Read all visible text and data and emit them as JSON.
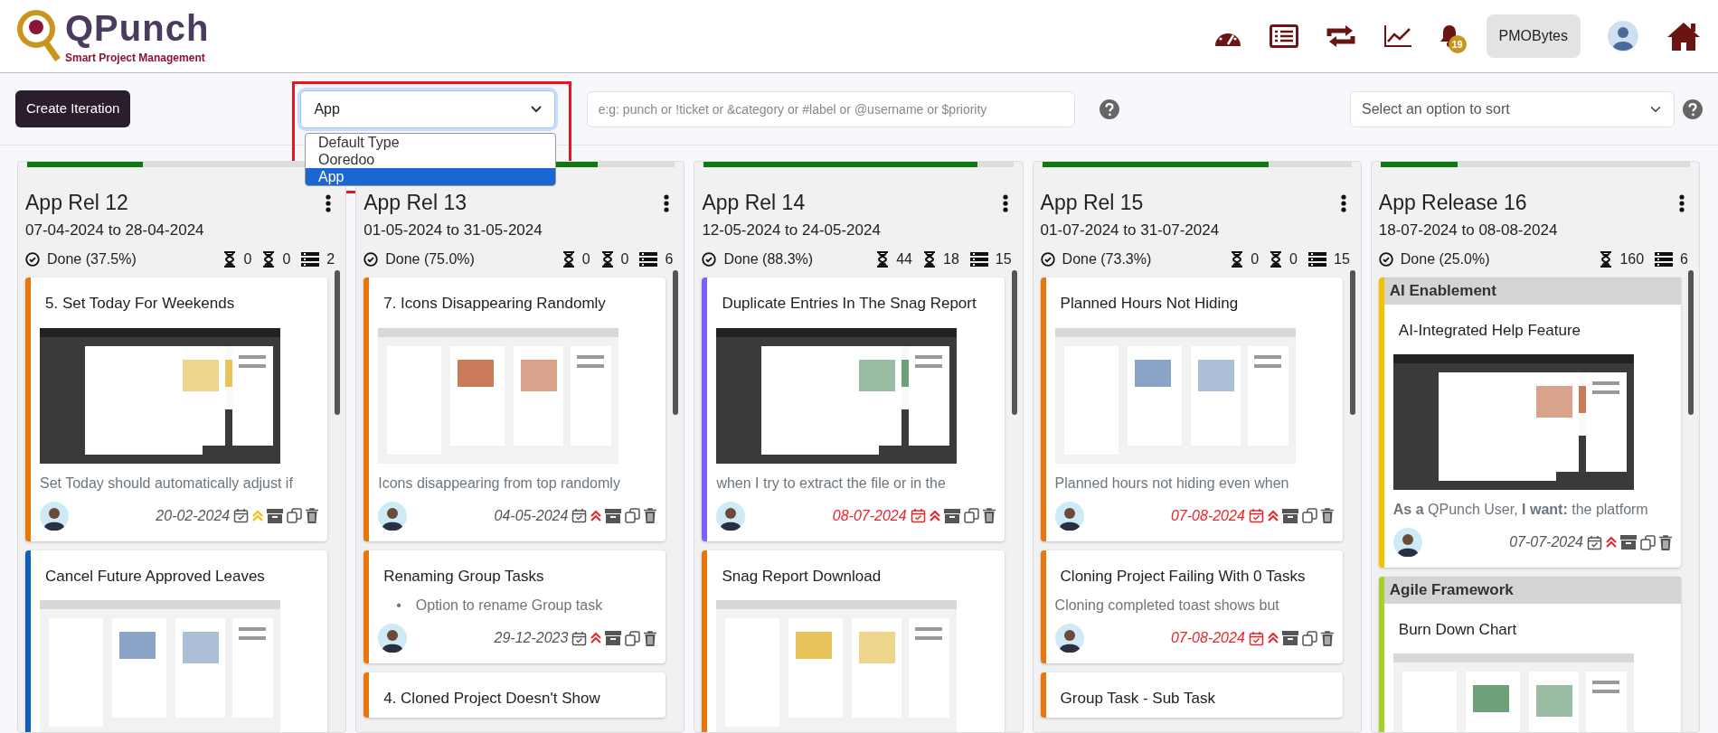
{
  "header": {
    "logo_title": "QPunch",
    "logo_subtitle": "Smart Project Management",
    "notification_count": "19",
    "user_button": "PMOBytes"
  },
  "toolbar": {
    "create_button": "Create Iteration",
    "type_select": {
      "value": "App",
      "expanded": true,
      "options": [
        {
          "label": "Default Type",
          "selected": false
        },
        {
          "label": "Ooredoo",
          "selected": false
        },
        {
          "label": "App",
          "selected": true
        }
      ]
    },
    "search": {
      "placeholder": "e:g: punch or !ticket or &category or #label or @username or $priority"
    },
    "sort_select": {
      "placeholder": "Select an option to sort"
    }
  },
  "iterations": [
    {
      "title": "App Rel 12",
      "dates": "07-04-2024 to 28-04-2024",
      "level": 0.375,
      "done": "Done (37.5%)",
      "stats": [
        {
          "kind": "hourglass",
          "value": "0"
        },
        {
          "kind": "hourglass",
          "value": "0"
        },
        {
          "kind": "list",
          "value": "2"
        }
      ],
      "cards": [
        {
          "title": "5. Set Today For Weekends",
          "color": "#e8760a",
          "picture": true,
          "description": "Set Today should automatically adjust if",
          "date": "20-02-2024",
          "overdue": false,
          "high_priority": false
        },
        {
          "title": "Cancel Future Approved Leaves",
          "color": "#0d5fb8",
          "picture": true
        }
      ]
    },
    {
      "title": "App Rel 13",
      "dates": "01-05-2024 to 31-05-2024",
      "level": 0.75,
      "done": "Done (75.0%)",
      "stats": [
        {
          "kind": "hourglass",
          "value": "0"
        },
        {
          "kind": "hourglass",
          "value": "0"
        },
        {
          "kind": "list",
          "value": "6"
        }
      ],
      "cards": [
        {
          "title": "7. Icons Disappearing Randomly",
          "color": "#e8760a",
          "picture": true,
          "description": "Icons disappearing from top randomly",
          "date": "04-05-2024",
          "overdue": false,
          "high_priority": true
        },
        {
          "title": "Renaming Group Tasks",
          "color": "#e8760a",
          "bullets": [
            {
              "marker": "•",
              "text": "Option to rename Group task"
            }
          ],
          "date": "29-12-2023",
          "overdue": false,
          "high_priority": true
        },
        {
          "title": "4. Cloned Project Doesn't Show",
          "color": "#e8760a"
        }
      ]
    },
    {
      "title": "App Rel 14",
      "dates": "12-05-2024 to 24-05-2024",
      "level": 0.883,
      "done": "Done (88.3%)",
      "stats": [
        {
          "kind": "hourglass",
          "value": "44"
        },
        {
          "kind": "hourglass",
          "value": "18"
        },
        {
          "kind": "list",
          "value": "15"
        }
      ],
      "cards": [
        {
          "title": "Duplicate Entries In The Snag Report",
          "color": "#7b61ff",
          "picture": true,
          "description": "when I try to extract the file or in the",
          "date": "08-07-2024",
          "overdue": true,
          "high_priority": true
        },
        {
          "title": "Snag Report Download",
          "color": "#e8760a",
          "picture": true
        }
      ]
    },
    {
      "title": "App Rel 15",
      "dates": "01-07-2024 to 31-07-2024",
      "level": 0.733,
      "done": "Done (73.3%)",
      "stats": [
        {
          "kind": "hourglass",
          "value": "0"
        },
        {
          "kind": "hourglass",
          "value": "0"
        },
        {
          "kind": "list",
          "value": "15"
        }
      ],
      "cards": [
        {
          "title": "Planned Hours Not Hiding",
          "color": "#e8760a",
          "picture": true,
          "description": "Planned hours not hiding even when",
          "date": "07-08-2024",
          "overdue": true,
          "high_priority": true
        },
        {
          "title": "Cloning Project Failing With 0 Tasks",
          "color": "#e8760a",
          "description": "Cloning completed toast shows but",
          "date": "07-08-2024",
          "overdue": true,
          "high_priority": true
        },
        {
          "title": "Group Task - Sub Task",
          "color": "#e8760a"
        }
      ]
    },
    {
      "title": "App Release 16",
      "dates": "18-07-2024 to 08-08-2024",
      "level": 0.25,
      "done": "Done (25.0%)",
      "stats": [
        {
          "kind": "hourglass",
          "value": "160"
        },
        {
          "kind": "list",
          "value": "6"
        }
      ],
      "cards": [
        {
          "group": "AI Enablement",
          "title": "AI-Integrated Help Feature",
          "color": "#f2c200",
          "picture": true,
          "description": "**As a** QPunch User, **I want:** the platform",
          "date": "07-07-2024",
          "overdue": false,
          "high_priority": true
        },
        {
          "group": "Agile Framework",
          "title": "Burn Down Chart",
          "color": "#a6d12a",
          "picture": true
        }
      ]
    }
  ]
}
